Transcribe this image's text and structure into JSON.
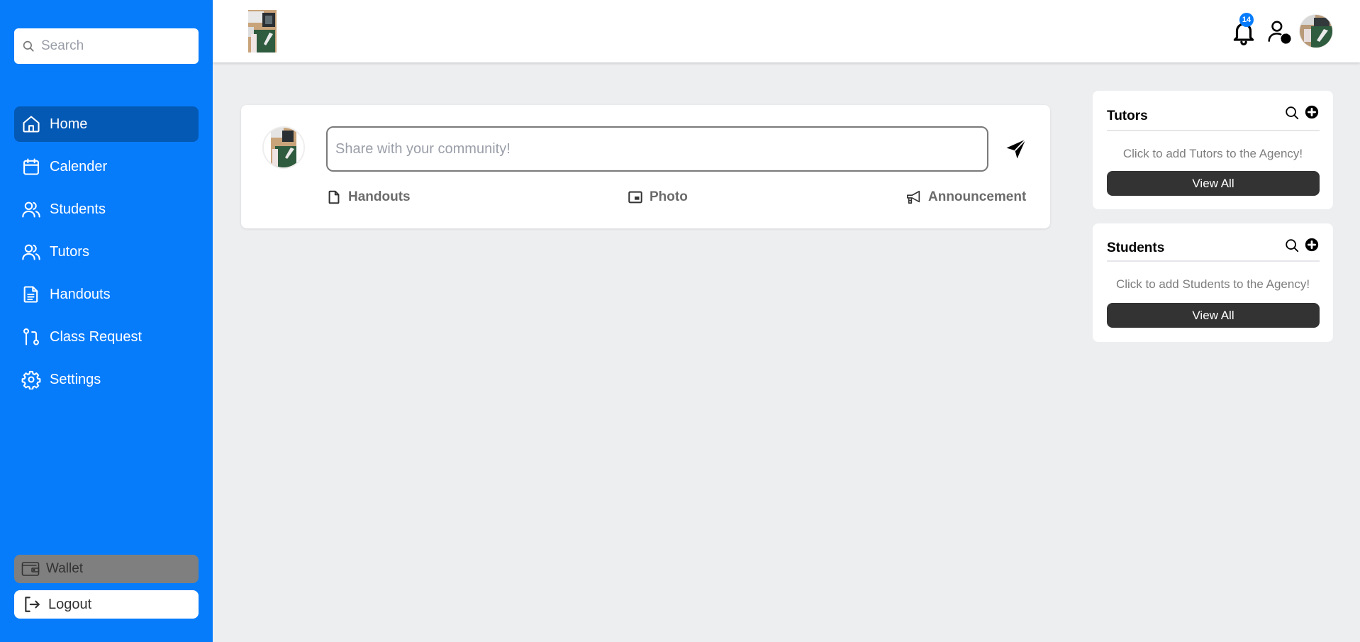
{
  "sidebar": {
    "search": {
      "placeholder": "Search",
      "icon": "search-icon"
    },
    "items": [
      {
        "label": "Home",
        "icon": "home-icon",
        "active": true
      },
      {
        "label": "Calender",
        "icon": "calendar-icon",
        "active": false
      },
      {
        "label": "Students",
        "icon": "users-icon",
        "active": false
      },
      {
        "label": "Tutors",
        "icon": "users-icon",
        "active": false
      },
      {
        "label": "Handouts",
        "icon": "document-icon",
        "active": false
      },
      {
        "label": "Class Request",
        "icon": "git-pull-request-icon",
        "active": false
      },
      {
        "label": "Settings",
        "icon": "gear-icon",
        "active": false
      }
    ],
    "wallet": {
      "label": "Wallet",
      "icon": "wallet-icon"
    },
    "logout": {
      "label": "Logout",
      "icon": "logout-icon"
    }
  },
  "header": {
    "notifications": {
      "count": "14",
      "icon": "bell-icon"
    },
    "user_settings_icon": "user-gear-icon",
    "avatar_icon": "avatar"
  },
  "composer": {
    "placeholder": "Share with your community!",
    "value": "",
    "send_icon": "send-icon",
    "actions": [
      {
        "label": "Handouts",
        "icon": "file-icon"
      },
      {
        "label": "Photo",
        "icon": "picture-in-picture-icon"
      },
      {
        "label": "Announcement",
        "icon": "megaphone-icon"
      }
    ]
  },
  "widgets": {
    "tutors": {
      "title": "Tutors",
      "message": "Click to add Tutors to the Agency!",
      "button": "View All"
    },
    "students": {
      "title": "Students",
      "message": "Click to add Students to the Agency!",
      "button": "View All"
    }
  },
  "colors": {
    "primary": "#077cfb",
    "active_nav": "#0359b3",
    "badge": "#077cfb",
    "view_all_button": "#333333",
    "background": "#edeef0"
  }
}
